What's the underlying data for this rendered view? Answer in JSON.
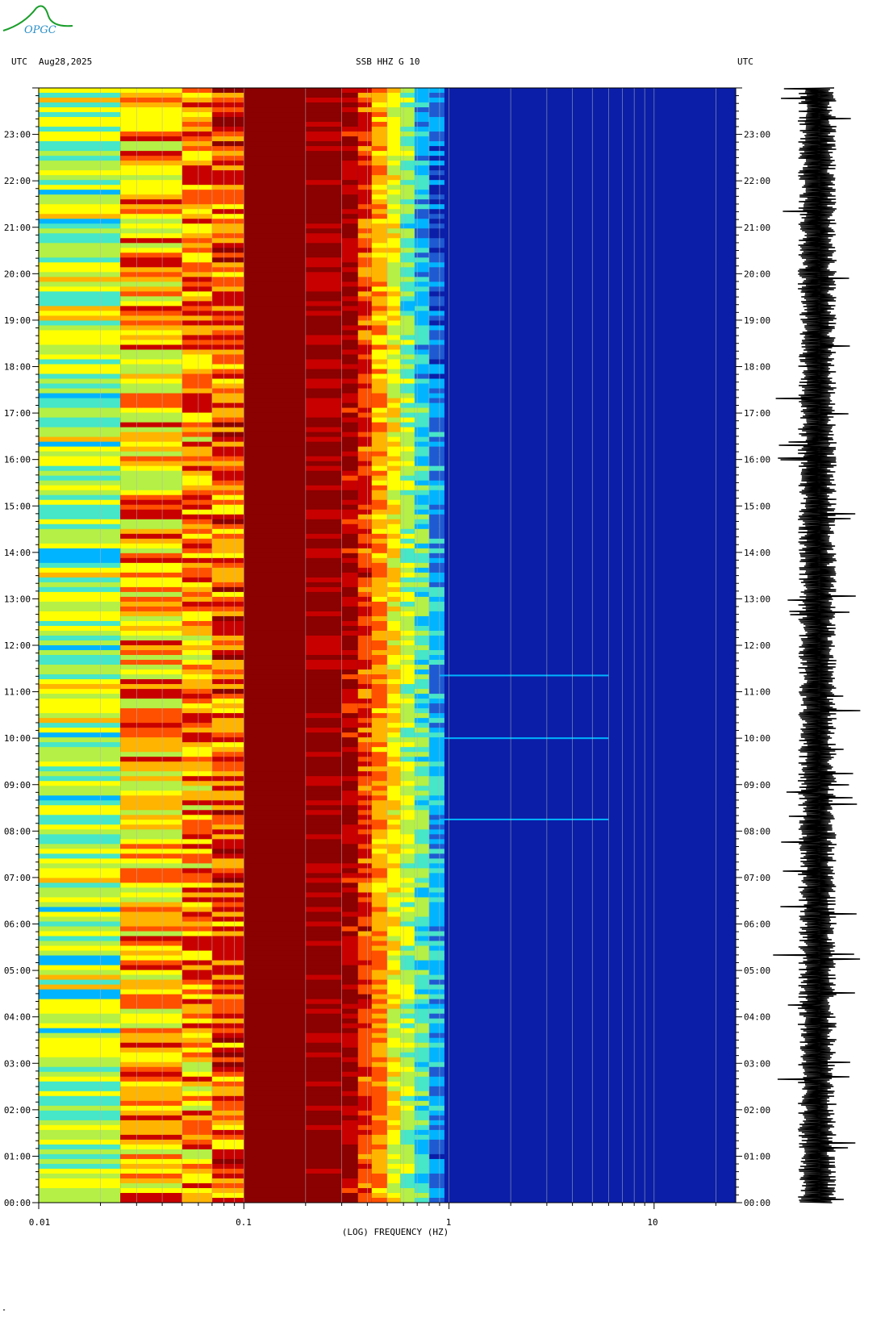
{
  "header": {
    "left_utc": "UTC",
    "date": "Aug28,2025",
    "station": "SSB HHZ G 10",
    "right_utc": "UTC"
  },
  "logo": {
    "text": "OPGC"
  },
  "corner_mark": "\"",
  "colors": {
    "accent": "#1b9e2c",
    "logo_text": "#2a8fc8",
    "background_blue": "#0a1ea8",
    "dark_red": "#8b0000"
  },
  "chart_data": {
    "type": "heatmap",
    "title": "SSB HHZ G 10",
    "xlabel": "(LOG) FREQUENCY (HZ)",
    "ylabel": "UTC",
    "x_scale": "log",
    "xlim": [
      0.01,
      25
    ],
    "ylim_hours": [
      0,
      24
    ],
    "x_ticks": [
      {
        "value": 0.01,
        "label": "0.01"
      },
      {
        "value": 0.1,
        "label": "0.1"
      },
      {
        "value": 1,
        "label": "1"
      },
      {
        "value": 10,
        "label": "10"
      }
    ],
    "y_ticks": [
      "00:00",
      "01:00",
      "02:00",
      "03:00",
      "04:00",
      "05:00",
      "06:00",
      "07:00",
      "08:00",
      "09:00",
      "10:00",
      "11:00",
      "12:00",
      "13:00",
      "14:00",
      "15:00",
      "16:00",
      "17:00",
      "18:00",
      "19:00",
      "20:00",
      "21:00",
      "22:00",
      "23:00"
    ],
    "y_tick_hours": [
      0,
      1,
      2,
      3,
      4,
      5,
      6,
      7,
      8,
      9,
      10,
      11,
      12,
      13,
      14,
      15,
      16,
      17,
      18,
      19,
      20,
      21,
      22,
      23
    ],
    "colormap": [
      "#00008b",
      "#0a1ea8",
      "#1e5ad2",
      "#00b4ff",
      "#46e6c8",
      "#b4f046",
      "#ffff00",
      "#ffb400",
      "#ff5000",
      "#c80000",
      "#8b0000"
    ],
    "frequency_bands": [
      {
        "f_range": [
          0.01,
          0.025
        ],
        "dominant": "green-cyan"
      },
      {
        "f_range": [
          0.025,
          0.07
        ],
        "dominant": "yellow-orange-red"
      },
      {
        "f_range": [
          0.07,
          0.1
        ],
        "dominant": "orange-red"
      },
      {
        "f_range": [
          0.1,
          0.3
        ],
        "dominant": "dark red"
      },
      {
        "f_range": [
          0.3,
          0.9
        ],
        "dominant": "transition red to blue"
      },
      {
        "f_range": [
          0.9,
          25
        ],
        "dominant": "blue"
      }
    ],
    "notable_events_hours": [
      8.25,
      10.0,
      11.35
    ],
    "seismogram": "daily trace at right"
  }
}
